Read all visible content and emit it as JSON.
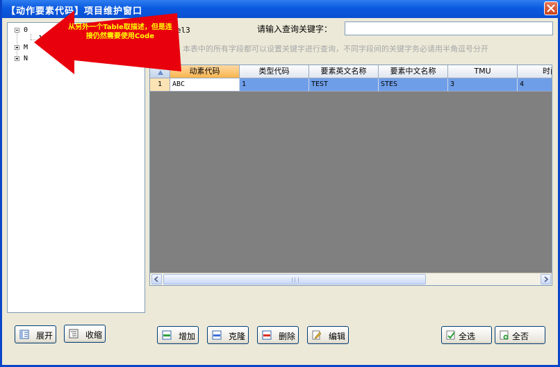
{
  "window": {
    "title": "【动作要素代码】项目维护窗口"
  },
  "tree": {
    "nodes": [
      {
        "label": "0",
        "expanded": true
      },
      {
        "label": "13"
      },
      {
        "label": "M",
        "expanded": false
      },
      {
        "label": "N",
        "expanded": false
      }
    ]
  },
  "annotation": {
    "text": "从另外一个Table取描述，但是连接仍然需要使用Code",
    "color": "#e8000d"
  },
  "header": {
    "label3": "label3",
    "search_label": "请输入查询关键字：",
    "search_value": "",
    "hint": "提示：本表中的所有字段都可以设置关键字进行查询，不同字段间的关键字务必请用半角逗号分开"
  },
  "grid": {
    "columns": [
      "动素代码",
      "类型代码",
      "要素英文名称",
      "要素中文名称",
      "TMU",
      "时间"
    ],
    "rows": [
      {
        "index": "1",
        "cells": [
          "ABC",
          "1",
          "TEST",
          "STES",
          "3",
          "4"
        ]
      }
    ]
  },
  "buttons": {
    "expand": "展开",
    "collapse": "收缩",
    "add": "增加",
    "clone": "克隆",
    "delete": "删除",
    "edit": "编辑",
    "select_all": "全选",
    "select_none": "全否"
  },
  "colors": {
    "titlebar": "#0a4fd2",
    "selected_row": "#6f9ee8",
    "grid_bg": "#808080"
  }
}
